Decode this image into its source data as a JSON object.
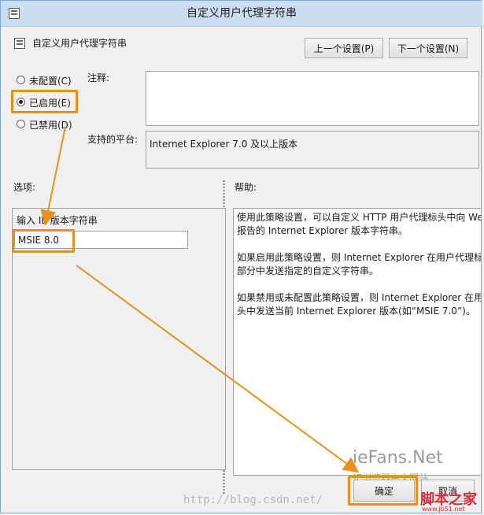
{
  "window": {
    "title": "自定义用户代理字符串"
  },
  "policy": {
    "name": "自定义用户代理字符串"
  },
  "nav": {
    "prev_label": "上一个设置(P)",
    "next_label": "下一个设置(N)"
  },
  "state": {
    "not_configured": "未配置(C)",
    "enabled": "已启用(E)",
    "disabled": "已禁用(D)"
  },
  "comment": {
    "label": "注释:"
  },
  "platform": {
    "label": "支持的平台:",
    "value": "Internet Explorer 7.0 及以上版本"
  },
  "options": {
    "label": "选项:",
    "field_label": "输入 IE 版本字符串",
    "field_value": "MSIE 8.0"
  },
  "help": {
    "label": "帮助:",
    "lines": [
      "使用此策略设置，可以自定义 HTTP 用户代理标头中向 We",
      "报告的 Internet Explorer 版本字符串。",
      "",
      "如果启用此策略设置，则 Internet Explorer 在用户代理标",
      "部分中发送指定的自定义字符串。",
      "",
      "如果禁用或未配置此策略设置，则 Internet Explorer 在用",
      "头中发送当前 Internet Explorer 版本(如“MSIE 7.0”)。"
    ]
  },
  "buttons": {
    "ok_label": "确定",
    "cancel_label": "取消"
  },
  "watermarks": {
    "site_name": "ieFans.Net",
    "site_sub": "IE浏览器中文网站",
    "blog_url": "http://blog.csdn.net/",
    "brand": "脚本之家",
    "brand_url": "www.jb51.net"
  },
  "colors": {
    "highlight": "#e6911c",
    "title_bar": "#c9dcf0"
  }
}
